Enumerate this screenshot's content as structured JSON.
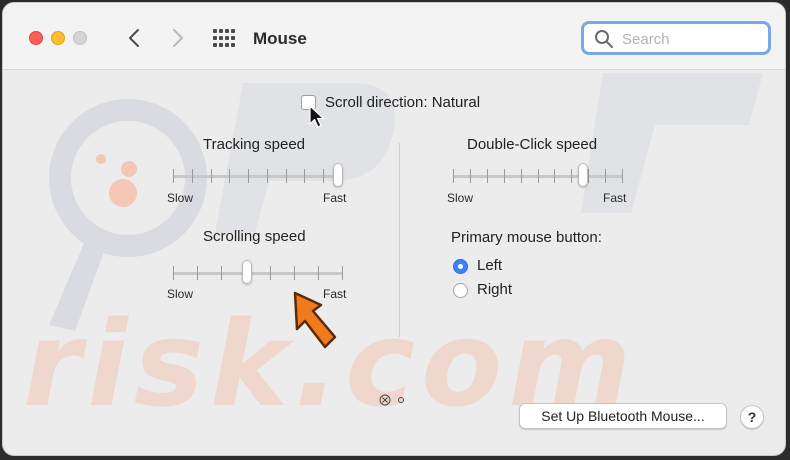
{
  "window": {
    "title": "Mouse",
    "traffic_lights": {
      "close": "#fe5f57",
      "minimize": "#febc2e",
      "zoom": "#d4d4d4"
    }
  },
  "toolbar": {
    "back_icon": "chevron-left-icon",
    "forward_icon": "chevron-right-icon",
    "show_all_icon": "grid-icon"
  },
  "search": {
    "placeholder": "Search",
    "value": "",
    "focus_color": "#7aa7e6"
  },
  "scroll_direction": {
    "label": "Scroll direction: Natural",
    "checked": false
  },
  "tracking_speed": {
    "label": "Tracking speed",
    "min_label": "Slow",
    "max_label": "Fast",
    "ticks": 10,
    "value": 1.0
  },
  "scrolling_speed": {
    "label": "Scrolling speed",
    "min_label": "Slow",
    "max_label": "Fast",
    "ticks": 8,
    "value": 0.43
  },
  "double_click_speed": {
    "label": "Double-Click speed",
    "min_label": "Slow",
    "max_label": "Fast",
    "ticks": 11,
    "value": 0.78
  },
  "primary_button": {
    "label": "Primary mouse button:",
    "options": [
      {
        "label": "Left",
        "selected": true
      },
      {
        "label": "Right",
        "selected": false
      }
    ],
    "accent": "#3b82f6"
  },
  "footer": {
    "bluetooth_button": "Set Up Bluetooth Mouse...",
    "help_button": "?"
  },
  "annotation": {
    "arrow_color": "#f07a1e"
  },
  "watermark": {
    "text": "risk.com",
    "color": "#f3b9a6"
  }
}
